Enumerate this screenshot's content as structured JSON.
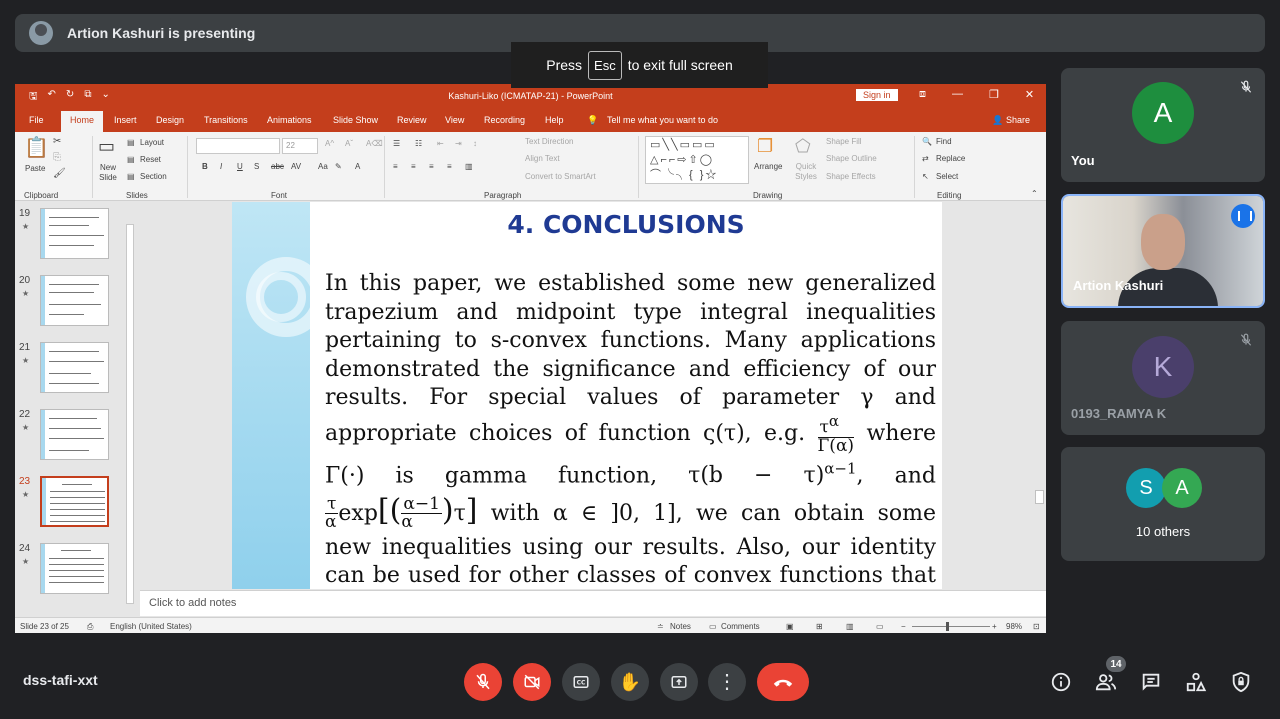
{
  "presenter": {
    "text": "Artion Kashuri is presenting"
  },
  "esc_toast": {
    "press": "Press",
    "key": "Esc",
    "rest": "to exit full screen"
  },
  "powerpoint": {
    "window_title": "Kashuri-Liko (ICMATAP-21) - PowerPoint",
    "sign_in": "Sign in",
    "menu": [
      "File",
      "Home",
      "Insert",
      "Design",
      "Transitions",
      "Animations",
      "Slide Show",
      "Review",
      "View",
      "Recording",
      "Help"
    ],
    "tell_me": "Tell me what you want to do",
    "share": "Share",
    "ribbon": {
      "paste": "Paste",
      "clipboard": "Clipboard",
      "new_slide": "New Slide",
      "layout": "Layout",
      "reset": "Reset",
      "section": "Section",
      "slides": "Slides",
      "font_size": "22",
      "font": "Font",
      "text_direction": "Text Direction",
      "align_text": "Align Text",
      "convert_smartart": "Convert to SmartArt",
      "paragraph": "Paragraph",
      "arrange": "Arrange",
      "quick_styles": "Quick Styles",
      "shape_fill": "Shape Fill",
      "shape_outline": "Shape Outline",
      "shape_effects": "Shape Effects",
      "drawing": "Drawing",
      "find": "Find",
      "replace": "Replace",
      "select": "Select",
      "editing": "Editing"
    },
    "thumbnails": [
      {
        "num": "19",
        "selected": false
      },
      {
        "num": "20",
        "selected": false
      },
      {
        "num": "21",
        "selected": false
      },
      {
        "num": "22",
        "selected": false
      },
      {
        "num": "23",
        "selected": true
      },
      {
        "num": "24",
        "selected": false
      }
    ],
    "slide": {
      "title": "4. CONCLUSIONS",
      "lines": [
        "In this paper, we established some new generalized",
        "trapezium and midpoint type integral inequalities",
        "pertaining to s-convex functions. Many applications",
        "demonstrated the significance and efficiency of our",
        "results. For special values of parameter γ  and"
      ],
      "line6_pre": "appropriate choices of function ς(τ), e.g.",
      "frac1_num": "τ",
      "frac1_sup": "α",
      "frac1_den": "Γ(α)",
      "line6_post": "where",
      "line7_a": "Γ(·)",
      "line7_b": "is",
      "line7_c": "gamma",
      "line7_d": "function,",
      "line7_e": "τ(b − τ)",
      "line7_sup": "α−1",
      "line7_f": ",",
      "line7_g": "and",
      "frac2_num": "τ",
      "frac2_den": "α",
      "line8_exp": "exp",
      "frac3_num": "α−1",
      "frac3_den": "α",
      "line8_post": "τ",
      "line8_rest": "with  α ∈ ]0, 1],  we  can  obtain  some",
      "lines_end": [
        "new inequalities using our results. Also, our identity",
        "can be used for other classes of convex functions that"
      ]
    },
    "notes_placeholder": "Click to add notes",
    "status": {
      "slide_of": "Slide 23 of 25",
      "language": "English (United States)",
      "notes": "Notes",
      "comments": "Comments",
      "zoom": "98%"
    }
  },
  "participants": [
    {
      "name": "You",
      "initial": "A",
      "color": "#1e8e3e",
      "muted": true
    },
    {
      "name": "Artion Kashuri",
      "speaking": true
    },
    {
      "name": "0193_RAMYA K",
      "initial": "K",
      "color": "#4a3f6b",
      "muted": true
    },
    {
      "name": "10 others",
      "initials": [
        "S",
        "A"
      ],
      "colors": [
        "#129eaf",
        "#34a853"
      ]
    }
  ],
  "meeting": {
    "code": "dss-tafi-xxt",
    "people_count": "14"
  }
}
